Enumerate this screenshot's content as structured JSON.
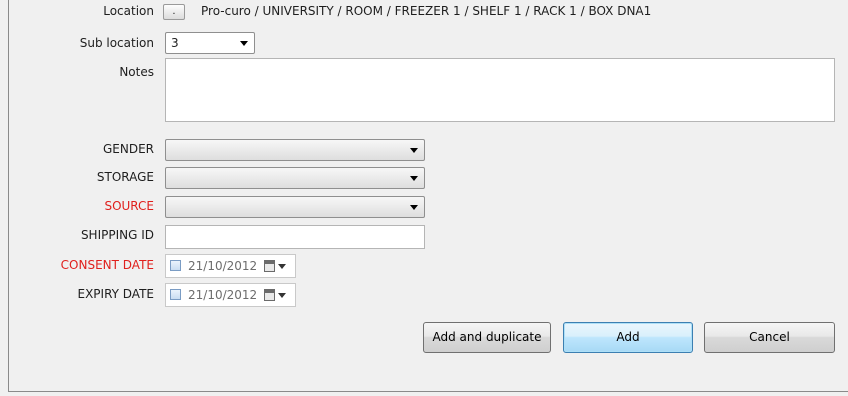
{
  "location": {
    "label": "Location",
    "button_label": ".",
    "path": "Pro-curo / UNIVERSITY / ROOM / FREEZER 1 / SHELF 1 / RACK 1 / BOX DNA1"
  },
  "sub_location": {
    "label": "Sub location",
    "value": "3"
  },
  "notes": {
    "label": "Notes",
    "value": ""
  },
  "fields": {
    "gender": {
      "label": "GENDER",
      "value": ""
    },
    "storage": {
      "label": "STORAGE",
      "value": ""
    },
    "source": {
      "label": "SOURCE",
      "value": ""
    },
    "shipping_id": {
      "label": "SHIPPING ID",
      "value": ""
    },
    "consent_date": {
      "label": "CONSENT DATE",
      "value": "21/10/2012"
    },
    "expiry_date": {
      "label": "EXPIRY DATE",
      "value": "21/10/2012"
    }
  },
  "buttons": {
    "add_duplicate": "Add and duplicate",
    "add": "Add",
    "cancel": "Cancel"
  },
  "colors": {
    "required_label": "#e0201d",
    "default_button_border": "#3c7fb1"
  }
}
